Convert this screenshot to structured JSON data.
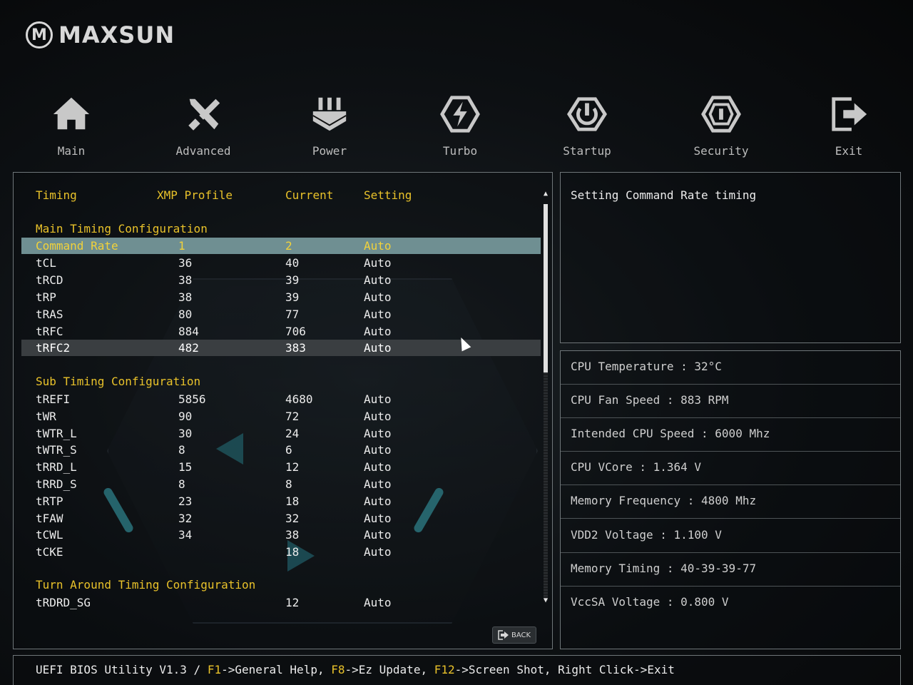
{
  "brand": {
    "name": "MAXSUN",
    "mark": "M"
  },
  "nav": [
    {
      "label": "Main",
      "icon": "home-icon"
    },
    {
      "label": "Advanced",
      "icon": "tools-icon"
    },
    {
      "label": "Power",
      "icon": "power-chip-icon"
    },
    {
      "label": "Turbo",
      "icon": "turbo-bolt-icon"
    },
    {
      "label": "Startup",
      "icon": "startup-power-icon"
    },
    {
      "label": "Security",
      "icon": "security-shield-icon"
    },
    {
      "label": "Exit",
      "icon": "exit-icon"
    }
  ],
  "table": {
    "headers": {
      "timing": "Timing",
      "xmp": "XMP Profile",
      "current": "Current",
      "setting": "Setting"
    },
    "sections": {
      "main": "Main Timing Configuration",
      "sub": "Sub Timing Configuration",
      "turnaround": "Turn Around Timing Configuration"
    },
    "rows": [
      {
        "name": "Command Rate",
        "xmp": "1",
        "current": "2",
        "setting": "Auto"
      },
      {
        "name": "tCL",
        "xmp": "36",
        "current": "40",
        "setting": "Auto"
      },
      {
        "name": "tRCD",
        "xmp": "38",
        "current": "39",
        "setting": "Auto"
      },
      {
        "name": "tRP",
        "xmp": "38",
        "current": "39",
        "setting": "Auto"
      },
      {
        "name": "tRAS",
        "xmp": "80",
        "current": "77",
        "setting": "Auto"
      },
      {
        "name": "tRFC",
        "xmp": "884",
        "current": "706",
        "setting": "Auto"
      },
      {
        "name": "tRFC2",
        "xmp": "482",
        "current": "383",
        "setting": "Auto"
      },
      {
        "name": "tREFI",
        "xmp": "5856",
        "current": "4680",
        "setting": "Auto"
      },
      {
        "name": "tWR",
        "xmp": "90",
        "current": "72",
        "setting": "Auto"
      },
      {
        "name": "tWTR_L",
        "xmp": "30",
        "current": "24",
        "setting": "Auto"
      },
      {
        "name": "tWTR_S",
        "xmp": "8",
        "current": "6",
        "setting": "Auto"
      },
      {
        "name": "tRRD_L",
        "xmp": "15",
        "current": "12",
        "setting": "Auto"
      },
      {
        "name": "tRRD_S",
        "xmp": "8",
        "current": "8",
        "setting": "Auto"
      },
      {
        "name": "tRTP",
        "xmp": "23",
        "current": "18",
        "setting": "Auto"
      },
      {
        "name": "tFAW",
        "xmp": "32",
        "current": "32",
        "setting": "Auto"
      },
      {
        "name": "tCWL",
        "xmp": "34",
        "current": "38",
        "setting": "Auto"
      },
      {
        "name": "tCKE",
        "xmp": "",
        "current": "18",
        "setting": "Auto"
      },
      {
        "name": "tRDRD_SG",
        "xmp": "",
        "current": "12",
        "setting": "Auto"
      }
    ]
  },
  "back_label": "BACK",
  "description": "Setting Command Rate timing",
  "status": [
    "CPU Temperature : 32°C",
    "CPU Fan Speed : 883 RPM",
    "Intended CPU Speed : 6000 Mhz",
    "CPU VCore : 1.364 V",
    "Memory Frequency : 4800 Mhz",
    "VDD2 Voltage : 1.100 V",
    "Memory Timing : 40-39-39-77",
    "VccSA Voltage : 0.800 V"
  ],
  "footer": {
    "prefix": "UEFI BIOS Utility V1.3 / ",
    "k1": "F1",
    "t1": "->General Help, ",
    "k2": "F8",
    "t2": "->Ez Update, ",
    "k3": "F12",
    "t3": "->Screen Shot, Right Click->Exit"
  },
  "colors": {
    "accent": "#e9c22a",
    "selected_row": "#6f8f92",
    "border": "#6f7679"
  }
}
